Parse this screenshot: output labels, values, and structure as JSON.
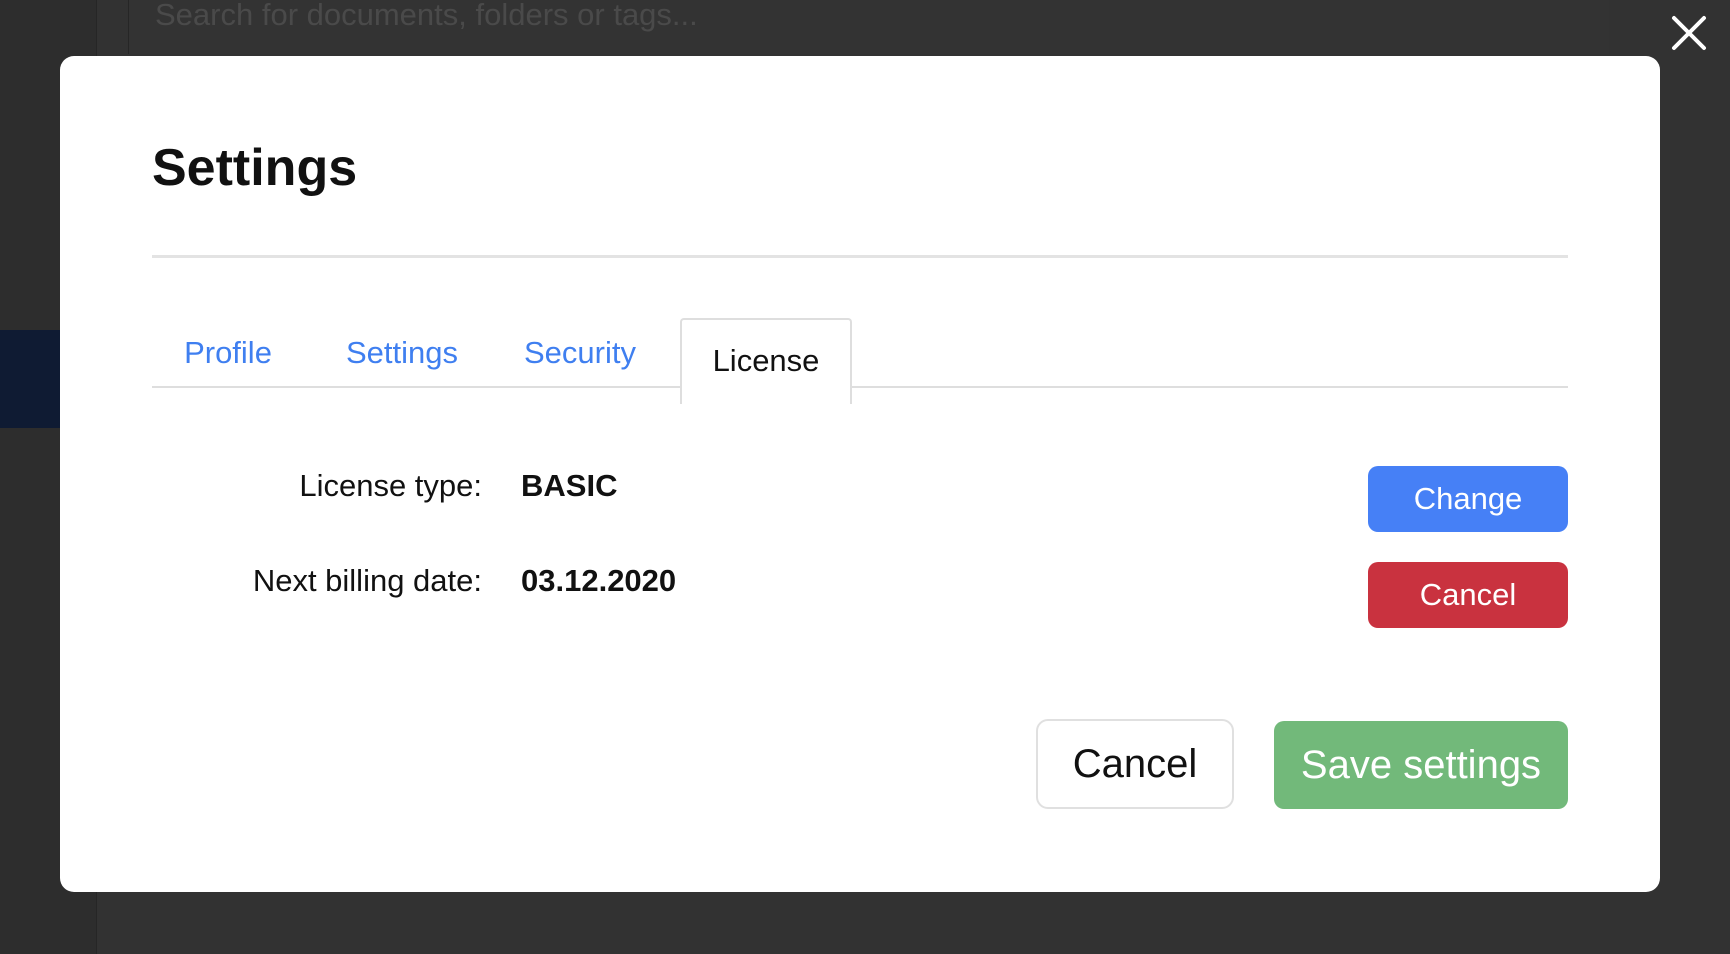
{
  "background": {
    "search": {
      "placeholder": "Search for documents, folders or tags..."
    }
  },
  "modal": {
    "title": "Settings",
    "tabs": [
      {
        "label": "Profile",
        "active": false
      },
      {
        "label": "Settings",
        "active": false
      },
      {
        "label": "Security",
        "active": false
      },
      {
        "label": "License",
        "active": true
      }
    ],
    "license": {
      "type_label": "License type:",
      "type_value": "BASIC",
      "billing_label": "Next billing date:",
      "billing_value": "03.12.2020",
      "change_button": "Change",
      "cancel_button": "Cancel"
    },
    "footer": {
      "cancel_label": "Cancel",
      "save_label": "Save settings"
    }
  },
  "icons": {
    "close": "close-icon"
  },
  "colors": {
    "accent_blue": "#4680f6",
    "tab_link": "#3f7ff0",
    "danger_red": "#c9323f",
    "success_green": "#72b97a",
    "overlay": "#323232"
  }
}
